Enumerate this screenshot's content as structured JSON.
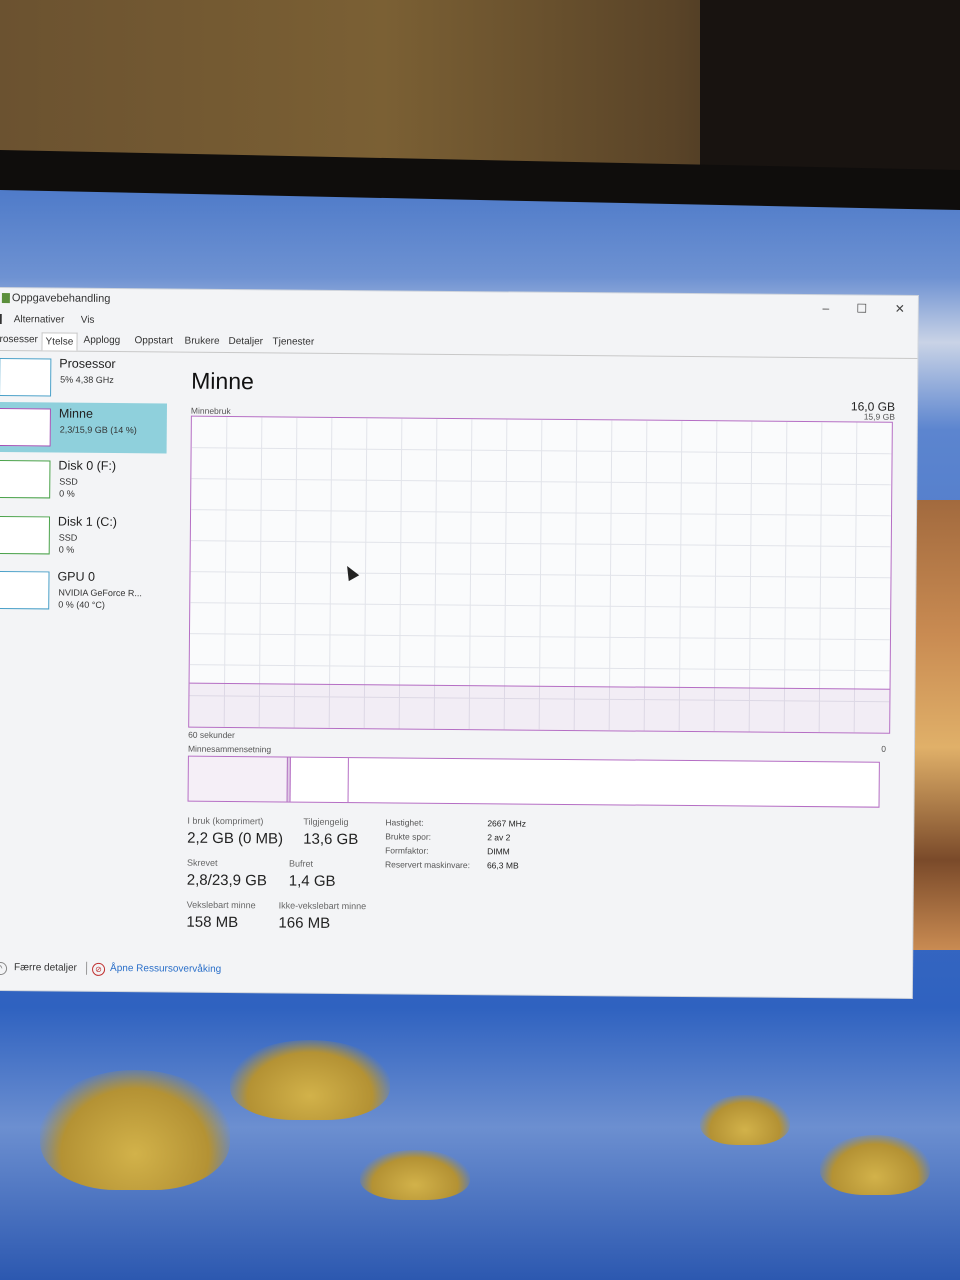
{
  "window": {
    "title": "Oppgavebehandling",
    "menu": [
      "Alternativer",
      "Vis"
    ],
    "tabs": [
      "rosesser",
      "Ytelse",
      "Applogg",
      "Oppstart",
      "Brukere",
      "Detaljer",
      "Tjenester"
    ],
    "active_tab": "Ytelse",
    "buttons": {
      "minimize": "–",
      "maximize": "☐",
      "close": "✕"
    }
  },
  "sidebar": {
    "items": [
      {
        "name": "Prosessor",
        "lines": [
          "5% 4,38 GHz"
        ],
        "icon": "cpu-graph"
      },
      {
        "name": "Minne",
        "lines": [
          "2,3/15,9 GB (14 %)"
        ],
        "icon": "memory-graph",
        "selected": true
      },
      {
        "name": "Disk 0 (F:)",
        "lines": [
          "SSD",
          "0 %"
        ],
        "icon": "disk-graph"
      },
      {
        "name": "Disk 1 (C:)",
        "lines": [
          "SSD",
          "0 %"
        ],
        "icon": "disk-graph"
      },
      {
        "name": "GPU 0",
        "lines": [
          "NVIDIA GeForce R...",
          "0 % (40 °C)"
        ],
        "icon": "gpu-graph"
      }
    ]
  },
  "main": {
    "title": "Minne",
    "total": "16,0 GB",
    "graph_label": "Minnebruk",
    "graph_max": "15,9 GB",
    "graph_time": "60 sekunder",
    "graph_zero": "0",
    "usage_fraction": 0.14,
    "composition_label": "Minnesammensetning",
    "stats": {
      "in_use_label": "I bruk (komprimert)",
      "in_use": "2,2 GB (0 MB)",
      "available_label": "Tilgjengelig",
      "available": "13,6 GB",
      "committed_label": "Skrevet",
      "committed": "2,8/23,9 GB",
      "cached_label": "Bufret",
      "cached": "1,4 GB",
      "paged_label": "Vekslebart minne",
      "paged": "158 MB",
      "nonpaged_label": "Ikke-vekslebart minne",
      "nonpaged": "166 MB"
    },
    "details": [
      {
        "label": "Hastighet:",
        "value": "2667 MHz"
      },
      {
        "label": "Brukte spor:",
        "value": "2 av 2"
      },
      {
        "label": "Formfaktor:",
        "value": "DIMM"
      },
      {
        "label": "Reservert maskinvare:",
        "value": "66,3 MB"
      }
    ]
  },
  "footer": {
    "fewer_details": "Færre detaljer",
    "resource_monitor": "Åpne Ressursovervåking"
  },
  "colors": {
    "accent_memory": "#b56ec4",
    "selected_bg": "#8fd0dc"
  }
}
